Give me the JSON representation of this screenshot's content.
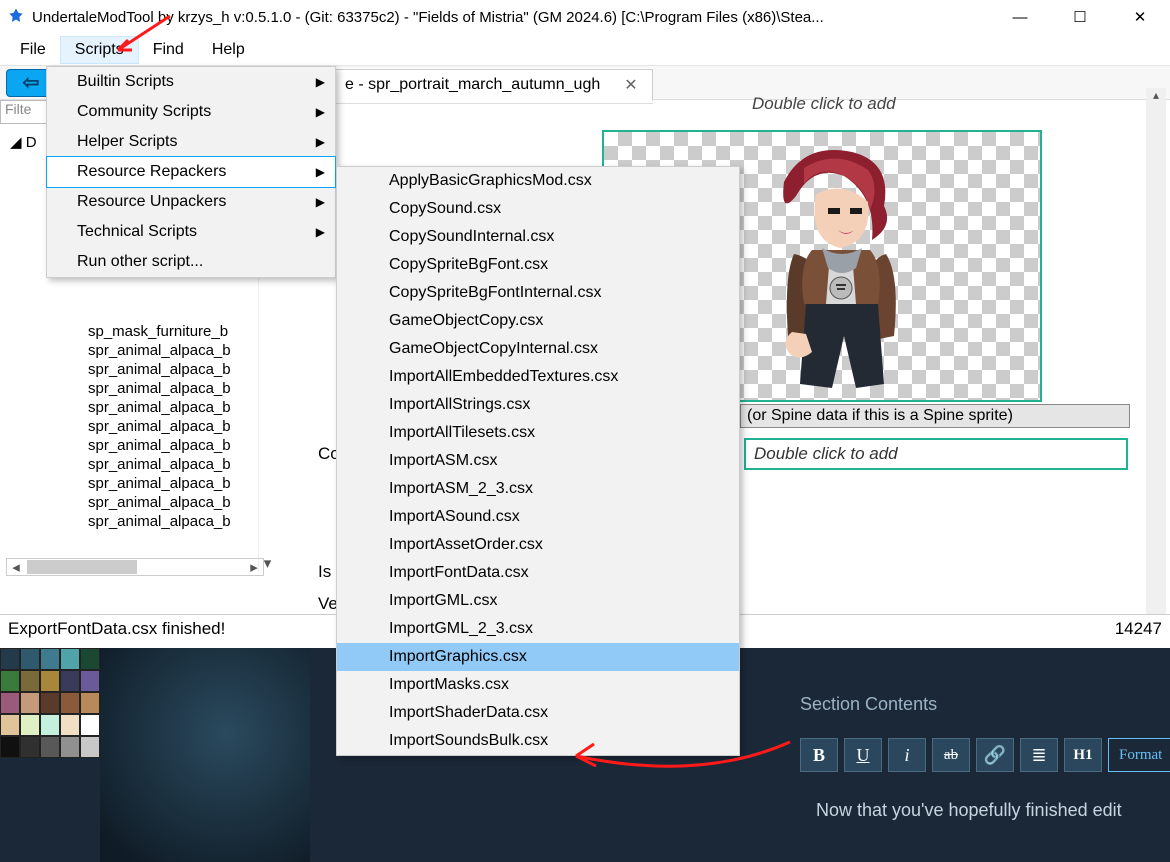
{
  "window": {
    "title": "UndertaleModTool by krzys_h v:0.5.1.0 - (Git: 63375c2) - \"Fields of Mistria\" (GM 2024.6) [C:\\Program Files (x86)\\Stea..."
  },
  "menubar": {
    "items": [
      "File",
      "Scripts",
      "Find",
      "Help"
    ],
    "active_index": 1
  },
  "toolbar": {
    "back": "⇦"
  },
  "tabs": {
    "open": [
      {
        "label": "e - spr_portrait_march_autumn_ugh",
        "close": "✕"
      }
    ]
  },
  "filter": {
    "placeholder": "Filte"
  },
  "tree": {
    "root_expand": "◢ D",
    "items": [
      "sp_mask_furniture_b",
      "spr_animal_alpaca_b",
      "spr_animal_alpaca_b",
      "spr_animal_alpaca_b",
      "spr_animal_alpaca_b",
      "spr_animal_alpaca_b",
      "spr_animal_alpaca_b",
      "spr_animal_alpaca_b",
      "spr_animal_alpaca_b",
      "spr_animal_alpaca_b",
      "spr_animal_alpaca_b"
    ]
  },
  "scripts_menu": {
    "items": [
      {
        "label": "Builtin Scripts",
        "submenu": true
      },
      {
        "label": "Community Scripts",
        "submenu": true
      },
      {
        "label": "Helper Scripts",
        "submenu": true
      },
      {
        "label": "Resource Repackers",
        "submenu": true,
        "highlight": true
      },
      {
        "label": "Resource Unpackers",
        "submenu": true
      },
      {
        "label": "Technical Scripts",
        "submenu": true
      },
      {
        "label": "Run other script...",
        "submenu": false
      }
    ]
  },
  "repackers_submenu": {
    "items": [
      "ApplyBasicGraphicsMod.csx",
      "CopySound.csx",
      "CopySoundInternal.csx",
      "CopySpriteBgFont.csx",
      "CopySpriteBgFontInternal.csx",
      "GameObjectCopy.csx",
      "GameObjectCopyInternal.csx",
      "ImportAllEmbeddedTextures.csx",
      "ImportAllStrings.csx",
      "ImportAllTilesets.csx",
      "ImportASM.csx",
      "ImportASM_2_3.csx",
      "ImportASound.csx",
      "ImportAssetOrder.csx",
      "ImportFontData.csx",
      "ImportGML.csx",
      "ImportGML_2_3.csx",
      "ImportGraphics.csx",
      "ImportMasks.csx",
      "ImportShaderData.csx",
      "ImportSoundsBulk.csx"
    ],
    "highlight_index": 17
  },
  "mid": {
    "co": "Co",
    "is": "Is s",
    "ve": "Ve"
  },
  "right": {
    "add_top": "Double click to add",
    "spine_hint": "(or Spine data if this is a Spine sprite)",
    "add_bot": "Double click to add"
  },
  "status": {
    "left": "ExportFontData.csx finished!",
    "right": "14247"
  },
  "dark": {
    "section": "Section Contents",
    "toolbar": {
      "bold": "B",
      "underline": "U",
      "italic": "i",
      "strike": "ab",
      "link": "🔗",
      "list": "≣",
      "h1": "H1",
      "format": "Format"
    },
    "body": "Now that you've hopefully finished edit",
    "palette": [
      "#223a4a",
      "#2f5a6e",
      "#407a8e",
      "#50a3a8",
      "#1a4833",
      "#3a7a3a",
      "#7a6a3a",
      "#a8863a",
      "#3a3a5a",
      "#6a5a9a",
      "#9a5a7a",
      "#c49a7a",
      "#5a3a2a",
      "#8a5a3a",
      "#b88a5a",
      "#e0c49a",
      "#dff0c4",
      "#c4f0dd",
      "#f0dfc4",
      "#ffffff",
      "#101010",
      "#303030",
      "#585858",
      "#909090",
      "#c8c8c8"
    ]
  }
}
